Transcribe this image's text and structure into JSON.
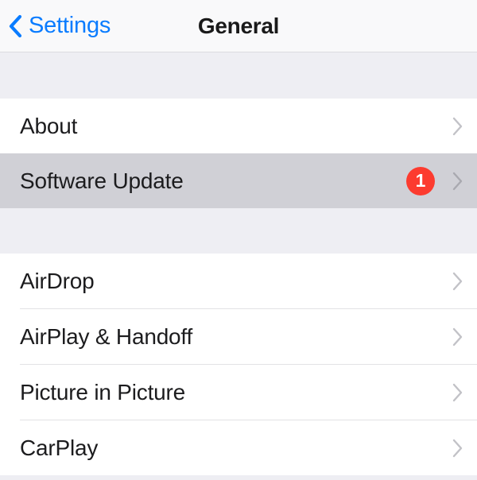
{
  "navbar": {
    "back_label": "Settings",
    "back_icon": "chevron-left-icon",
    "title": "General",
    "accent_color": "#0a7cff",
    "background_color": "#f9f9fa"
  },
  "theme": {
    "group_gap_color": "#eeeef3",
    "row_color": "#ffffff",
    "row_highlight_color": "#d0d0d6",
    "separator_color": "#e2e2e5",
    "badge_color": "#fc3b2f",
    "label_color": "#1c1c1e",
    "disclosure_color": "#c2c2c7"
  },
  "groups": [
    {
      "name": "device-info-group",
      "rows": [
        {
          "label": "About",
          "name": "row-about",
          "highlighted": false,
          "badge": null,
          "disclosure": true
        },
        {
          "label": "Software Update",
          "name": "row-software-update",
          "highlighted": true,
          "badge": "1",
          "disclosure": true
        }
      ]
    },
    {
      "name": "connectivity-group",
      "rows": [
        {
          "label": "AirDrop",
          "name": "row-airdrop",
          "highlighted": false,
          "badge": null,
          "disclosure": true
        },
        {
          "label": "AirPlay & Handoff",
          "name": "row-airplay-handoff",
          "highlighted": false,
          "badge": null,
          "disclosure": true
        },
        {
          "label": "Picture in Picture",
          "name": "row-picture-in-picture",
          "highlighted": false,
          "badge": null,
          "disclosure": true
        },
        {
          "label": "CarPlay",
          "name": "row-carplay",
          "highlighted": false,
          "badge": null,
          "disclosure": true
        }
      ]
    }
  ]
}
